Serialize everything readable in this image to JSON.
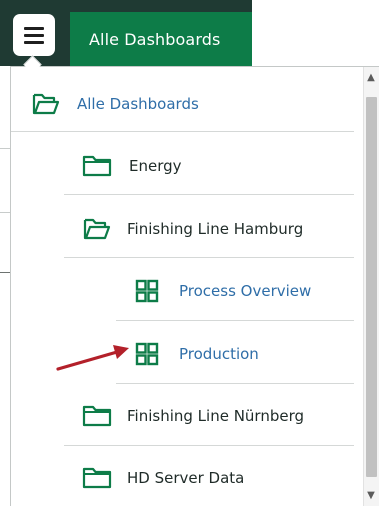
{
  "header": {
    "menu_icon": "hamburger-menu-icon",
    "active_tab": "Alle Dashboards"
  },
  "tree": {
    "items": [
      {
        "label": "Alle Dashboards",
        "icon": "folder-open-icon",
        "level": 0,
        "style": "link"
      },
      {
        "label": "Energy",
        "icon": "folder-icon",
        "level": 1
      },
      {
        "label": "Finishing Line Hamburg",
        "icon": "folder-open-icon",
        "level": 1
      },
      {
        "label": "Process Overview",
        "icon": "dashboard-grid-icon",
        "level": 2,
        "style": "link"
      },
      {
        "label": "Production",
        "icon": "dashboard-grid-icon",
        "level": 2,
        "style": "link"
      },
      {
        "label": "Finishing Line Nürnberg",
        "icon": "folder-icon",
        "level": 1
      },
      {
        "label": "HD Server Data",
        "icon": "folder-icon",
        "level": 1
      }
    ]
  },
  "scrollbar": {
    "up": "▲",
    "down": "▼"
  },
  "annotation": {
    "icon": "red-pointer-arrow-icon"
  },
  "colors": {
    "header_bg": "#1f3a33",
    "tab_bg": "#0d7c48",
    "icon_green": "#0d7c48",
    "link_blue": "#2f6ea8",
    "arrow_red": "#b3202a"
  }
}
